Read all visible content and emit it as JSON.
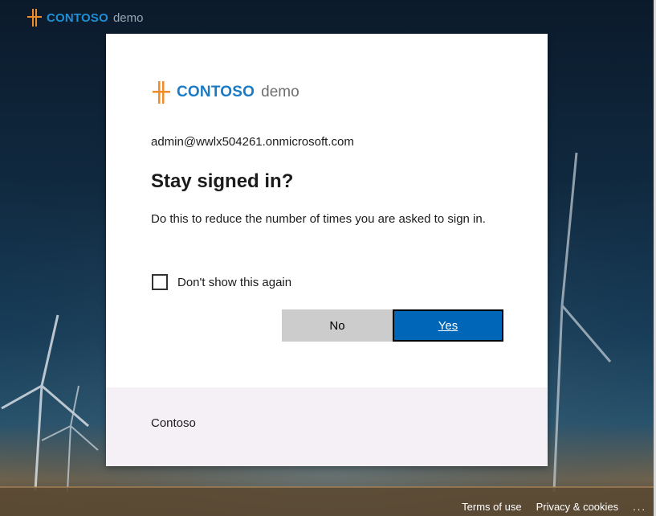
{
  "header": {
    "logo_brand": "CONTOSO",
    "logo_suffix": "demo"
  },
  "card": {
    "logo_brand": "CONTOSO",
    "logo_suffix": "demo",
    "email": "admin@wwlx504261.onmicrosoft.com",
    "title": "Stay signed in?",
    "description": "Do this to reduce the number of times you are asked to sign in.",
    "checkbox_label": "Don't show this again",
    "checkbox_checked": false,
    "no_label": "No",
    "yes_label": "Yes",
    "footer_text": "Contoso"
  },
  "footer": {
    "terms": "Terms of use",
    "privacy": "Privacy & cookies",
    "more": "..."
  },
  "colors": {
    "brand_blue": "#1a7bc4",
    "logo_orange": "#f28c28",
    "primary_button": "#0067b8",
    "secondary_button": "#cccccc"
  },
  "icons": {
    "logo": "contoso-logo-icon",
    "checkbox": "checkbox-icon",
    "more": "ellipsis-icon"
  }
}
